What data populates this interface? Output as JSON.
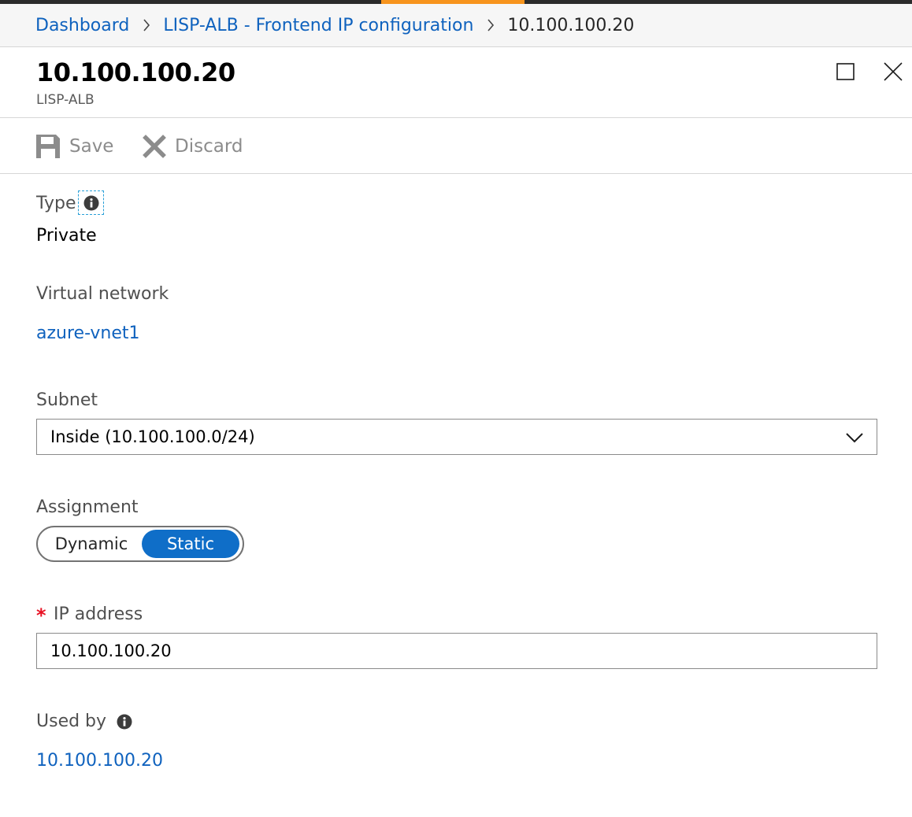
{
  "breadcrumb": {
    "items": [
      {
        "label": "Dashboard"
      },
      {
        "label": "LISP-ALB - Frontend IP configuration"
      }
    ],
    "current": "10.100.100.20"
  },
  "header": {
    "title": "10.100.100.20",
    "subtitle": "LISP-ALB"
  },
  "toolbar": {
    "save_label": "Save",
    "discard_label": "Discard"
  },
  "fields": {
    "type": {
      "label": "Type",
      "value": "Private"
    },
    "virtual_network": {
      "label": "Virtual network",
      "value": "azure-vnet1"
    },
    "subnet": {
      "label": "Subnet",
      "selected": "Inside (10.100.100.0/24)"
    },
    "assignment": {
      "label": "Assignment",
      "options": [
        "Dynamic",
        "Static"
      ],
      "selected": "Static"
    },
    "ip_address": {
      "required_mark": "*",
      "label": "IP address",
      "value": "10.100.100.20"
    },
    "used_by": {
      "label": "Used by",
      "value": "10.100.100.20"
    }
  },
  "icons": {
    "breadcrumb_separator": "chevron-right-icon",
    "maximize": "maximize-icon",
    "close": "close-icon",
    "save": "save-icon",
    "discard": "discard-icon",
    "info": "info-icon",
    "dropdown": "chevron-down-icon"
  },
  "colors": {
    "link": "#0f62be",
    "accent": "#f7941d",
    "toggle_selected": "#0f6ec8",
    "required": "#e81123",
    "disabled_text": "#8c8c8c"
  }
}
